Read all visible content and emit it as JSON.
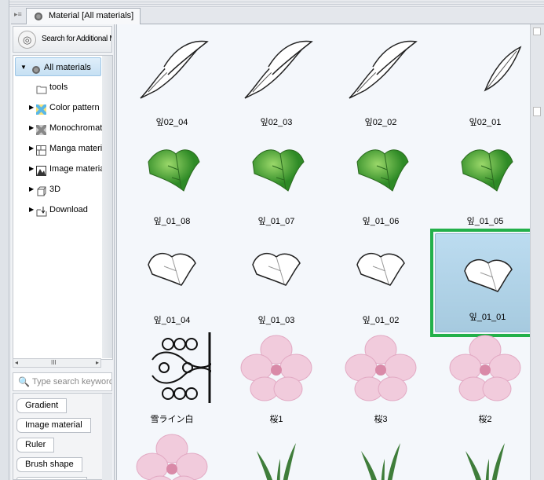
{
  "tab": {
    "title": "Material [All materials]"
  },
  "search_additional": "Search for Additional Materials",
  "tree": [
    {
      "label": "All materials",
      "icon": "materials-icon",
      "expanded": true,
      "selected": true,
      "level": 0
    },
    {
      "label": "tools",
      "icon": "folder-icon",
      "level": 1
    },
    {
      "label": "Color pattern",
      "icon": "color-pattern-icon",
      "level": 1,
      "expandable": true
    },
    {
      "label": "Monochromatic pattern",
      "icon": "monochromatic-icon",
      "level": 1,
      "expandable": true
    },
    {
      "label": "Manga material",
      "icon": "manga-icon",
      "level": 1,
      "expandable": true
    },
    {
      "label": "Image material",
      "icon": "image-icon",
      "level": 1,
      "expandable": true
    },
    {
      "label": "3D",
      "icon": "cube-icon",
      "level": 1,
      "expandable": true
    },
    {
      "label": "Download",
      "icon": "download-icon",
      "level": 1,
      "expandable": true
    }
  ],
  "keyword_placeholder": "Type search keywords",
  "tags": [
    "Gradient",
    "Image material",
    "Ruler",
    "Brush shape",
    ""
  ],
  "materials": [
    {
      "label": "잎02_04",
      "kind": "line-leaf"
    },
    {
      "label": "잎02_03",
      "kind": "line-leaf"
    },
    {
      "label": "잎02_02",
      "kind": "line-leaf"
    },
    {
      "label": "잎02_01",
      "kind": "line-leaf-small"
    },
    {
      "label": "잎_01_08",
      "kind": "green-leaf"
    },
    {
      "label": "잎_01_07",
      "kind": "green-leaf"
    },
    {
      "label": "잎_01_06",
      "kind": "green-leaf"
    },
    {
      "label": "잎_01_05",
      "kind": "green-leaf"
    },
    {
      "label": "잎_01_04",
      "kind": "white-leaf"
    },
    {
      "label": "잎_01_03",
      "kind": "white-leaf"
    },
    {
      "label": "잎_01_02",
      "kind": "white-leaf"
    },
    {
      "label": "잎_01_01",
      "kind": "white-leaf",
      "selected": true
    },
    {
      "label": "雪ライン白",
      "kind": "ornament"
    },
    {
      "label": "桜1",
      "kind": "blossom"
    },
    {
      "label": "桜3",
      "kind": "blossom"
    },
    {
      "label": "桜2",
      "kind": "blossom"
    },
    {
      "label": "",
      "kind": "blossom"
    },
    {
      "label": "",
      "kind": "grass"
    },
    {
      "label": "",
      "kind": "grass"
    },
    {
      "label": "",
      "kind": "grass"
    }
  ],
  "colors": {
    "selection_border": "#23b04a",
    "selection_fill": "#b4d6ec"
  }
}
